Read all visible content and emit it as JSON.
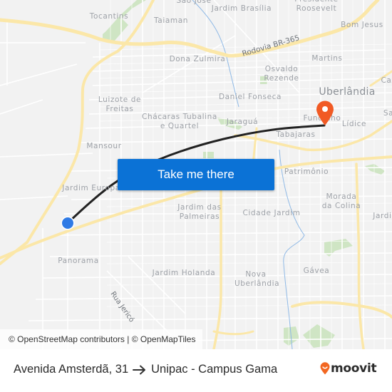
{
  "map": {
    "places": [
      {
        "name": "Tocantins",
        "kind": "neighborhood"
      },
      {
        "name": "Taiaman",
        "kind": "neighborhood"
      },
      {
        "name": "São José",
        "kind": "neighborhood"
      },
      {
        "name": "Jardim Brasília",
        "kind": "neighborhood"
      },
      {
        "name": "Presidente Roosevelt",
        "kind": "neighborhood"
      },
      {
        "name": "Bom Jesus",
        "kind": "neighborhood"
      },
      {
        "name": "Dona Zulmira",
        "kind": "neighborhood"
      },
      {
        "name": "Martins",
        "kind": "neighborhood"
      },
      {
        "name": "Osvaldo Rezende",
        "kind": "neighborhood"
      },
      {
        "name": "Luizote de Freitas",
        "kind": "neighborhood"
      },
      {
        "name": "Daniel Fonseca",
        "kind": "neighborhood"
      },
      {
        "name": "Uberlândia",
        "kind": "city"
      },
      {
        "name": "Chácaras Tubalina e Quartel",
        "kind": "neighborhood"
      },
      {
        "name": "Jaraguá",
        "kind": "neighborhood"
      },
      {
        "name": "Fundinho",
        "kind": "neighborhood"
      },
      {
        "name": "Lídice",
        "kind": "neighborhood"
      },
      {
        "name": "Tabajaras",
        "kind": "neighborhood"
      },
      {
        "name": "Mansour",
        "kind": "neighborhood"
      },
      {
        "name": "Jardim Europa",
        "kind": "neighborhood"
      },
      {
        "name": "Patrimônio",
        "kind": "neighborhood"
      },
      {
        "name": "Jardim das Palmeiras",
        "kind": "neighborhood"
      },
      {
        "name": "Cidade Jardim",
        "kind": "neighborhood"
      },
      {
        "name": "Morada da Colina",
        "kind": "neighborhood"
      },
      {
        "name": "Panorama",
        "kind": "neighborhood"
      },
      {
        "name": "Jardim Holanda",
        "kind": "neighborhood"
      },
      {
        "name": "Nova Uberlândia",
        "kind": "neighborhood"
      },
      {
        "name": "Gávea",
        "kind": "neighborhood"
      },
      {
        "name": "Caz",
        "kind": "neighborhood-partial"
      },
      {
        "name": "Sa",
        "kind": "neighborhood-partial"
      },
      {
        "name": "Jardin",
        "kind": "neighborhood-partial"
      }
    ],
    "road_labels": {
      "br365": "Rodovia BR-365",
      "jerico": "Rua Jericó"
    },
    "origin_marker": {
      "icon": "origin-dot-icon",
      "color": "#2f7ae5"
    },
    "destination_marker": {
      "icon": "map-pin-icon",
      "color": "#f15a24"
    },
    "route_color": "#222222",
    "attribution": "© OpenStreetMap contributors | © OpenMapTiles"
  },
  "cta": {
    "label": "Take me there",
    "color": "#0b72d6"
  },
  "footer": {
    "origin": "Avenida Amsterdã, 31",
    "arrow_icon": "arrow-right-icon",
    "destination": "Unipac - Campus Gama",
    "logo_text": "moovit",
    "logo_color": "#f26722"
  }
}
